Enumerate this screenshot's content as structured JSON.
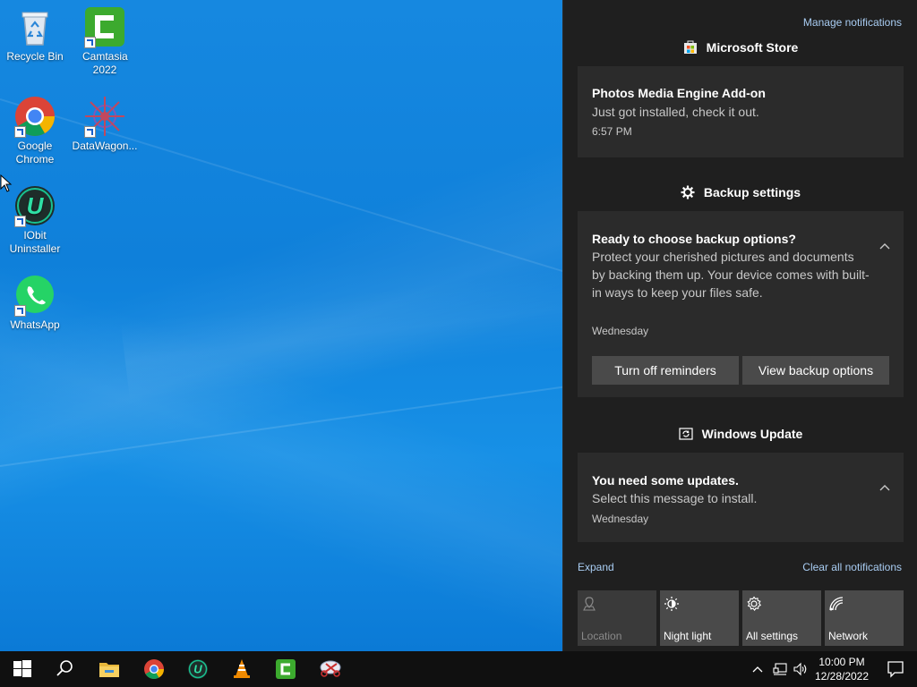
{
  "desktop": {
    "icons": [
      {
        "label": "Recycle Bin",
        "icon": "recycle-bin-icon"
      },
      {
        "label": "Camtasia 2022",
        "icon": "camtasia-icon"
      },
      {
        "label": "Google Chrome",
        "icon": "chrome-icon"
      },
      {
        "label": "DataWagon...",
        "icon": "datawagon-icon"
      },
      {
        "label": "IObit Uninstaller",
        "icon": "iobit-uninstaller-icon"
      },
      {
        "label": "WhatsApp",
        "icon": "whatsapp-icon"
      }
    ]
  },
  "action_center": {
    "manage_notifications": "Manage notifications",
    "groups": [
      {
        "app": "Microsoft Store",
        "icon": "microsoft-store-icon",
        "notification": {
          "title": "Photos Media Engine Add-on",
          "body": "Just got installed, check it out.",
          "time": "6:57 PM"
        }
      },
      {
        "app": "Backup settings",
        "icon": "gear-icon",
        "notification": {
          "title": "Ready to choose backup options?",
          "body": "Protect your cherished pictures and documents by backing them up. Your device comes with built-in ways to keep your files safe.",
          "time": "Wednesday",
          "buttons": [
            "Turn off reminders",
            "View backup options"
          ]
        }
      },
      {
        "app": "Windows Update",
        "icon": "windows-update-icon",
        "notification": {
          "title": "You need some updates.",
          "body": "Select this message to install.",
          "time": "Wednesday"
        }
      }
    ],
    "expand": "Expand",
    "clear_all": "Clear all notifications",
    "quick_actions": [
      {
        "label": "Location",
        "icon": "location-icon",
        "state": "off"
      },
      {
        "label": "Night light",
        "icon": "night-light-icon",
        "state": "available"
      },
      {
        "label": "All settings",
        "icon": "settings-icon",
        "state": "available"
      },
      {
        "label": "Network",
        "icon": "network-icon",
        "state": "available"
      }
    ]
  },
  "taskbar": {
    "items": [
      "start-icon",
      "search-icon",
      "file-explorer-icon",
      "chrome-icon",
      "iobit-uninstaller-icon",
      "vlc-icon",
      "camtasia-icon",
      "snipping-tool-icon"
    ],
    "clock": {
      "time": "10:00 PM",
      "date": "12/28/2022"
    }
  }
}
